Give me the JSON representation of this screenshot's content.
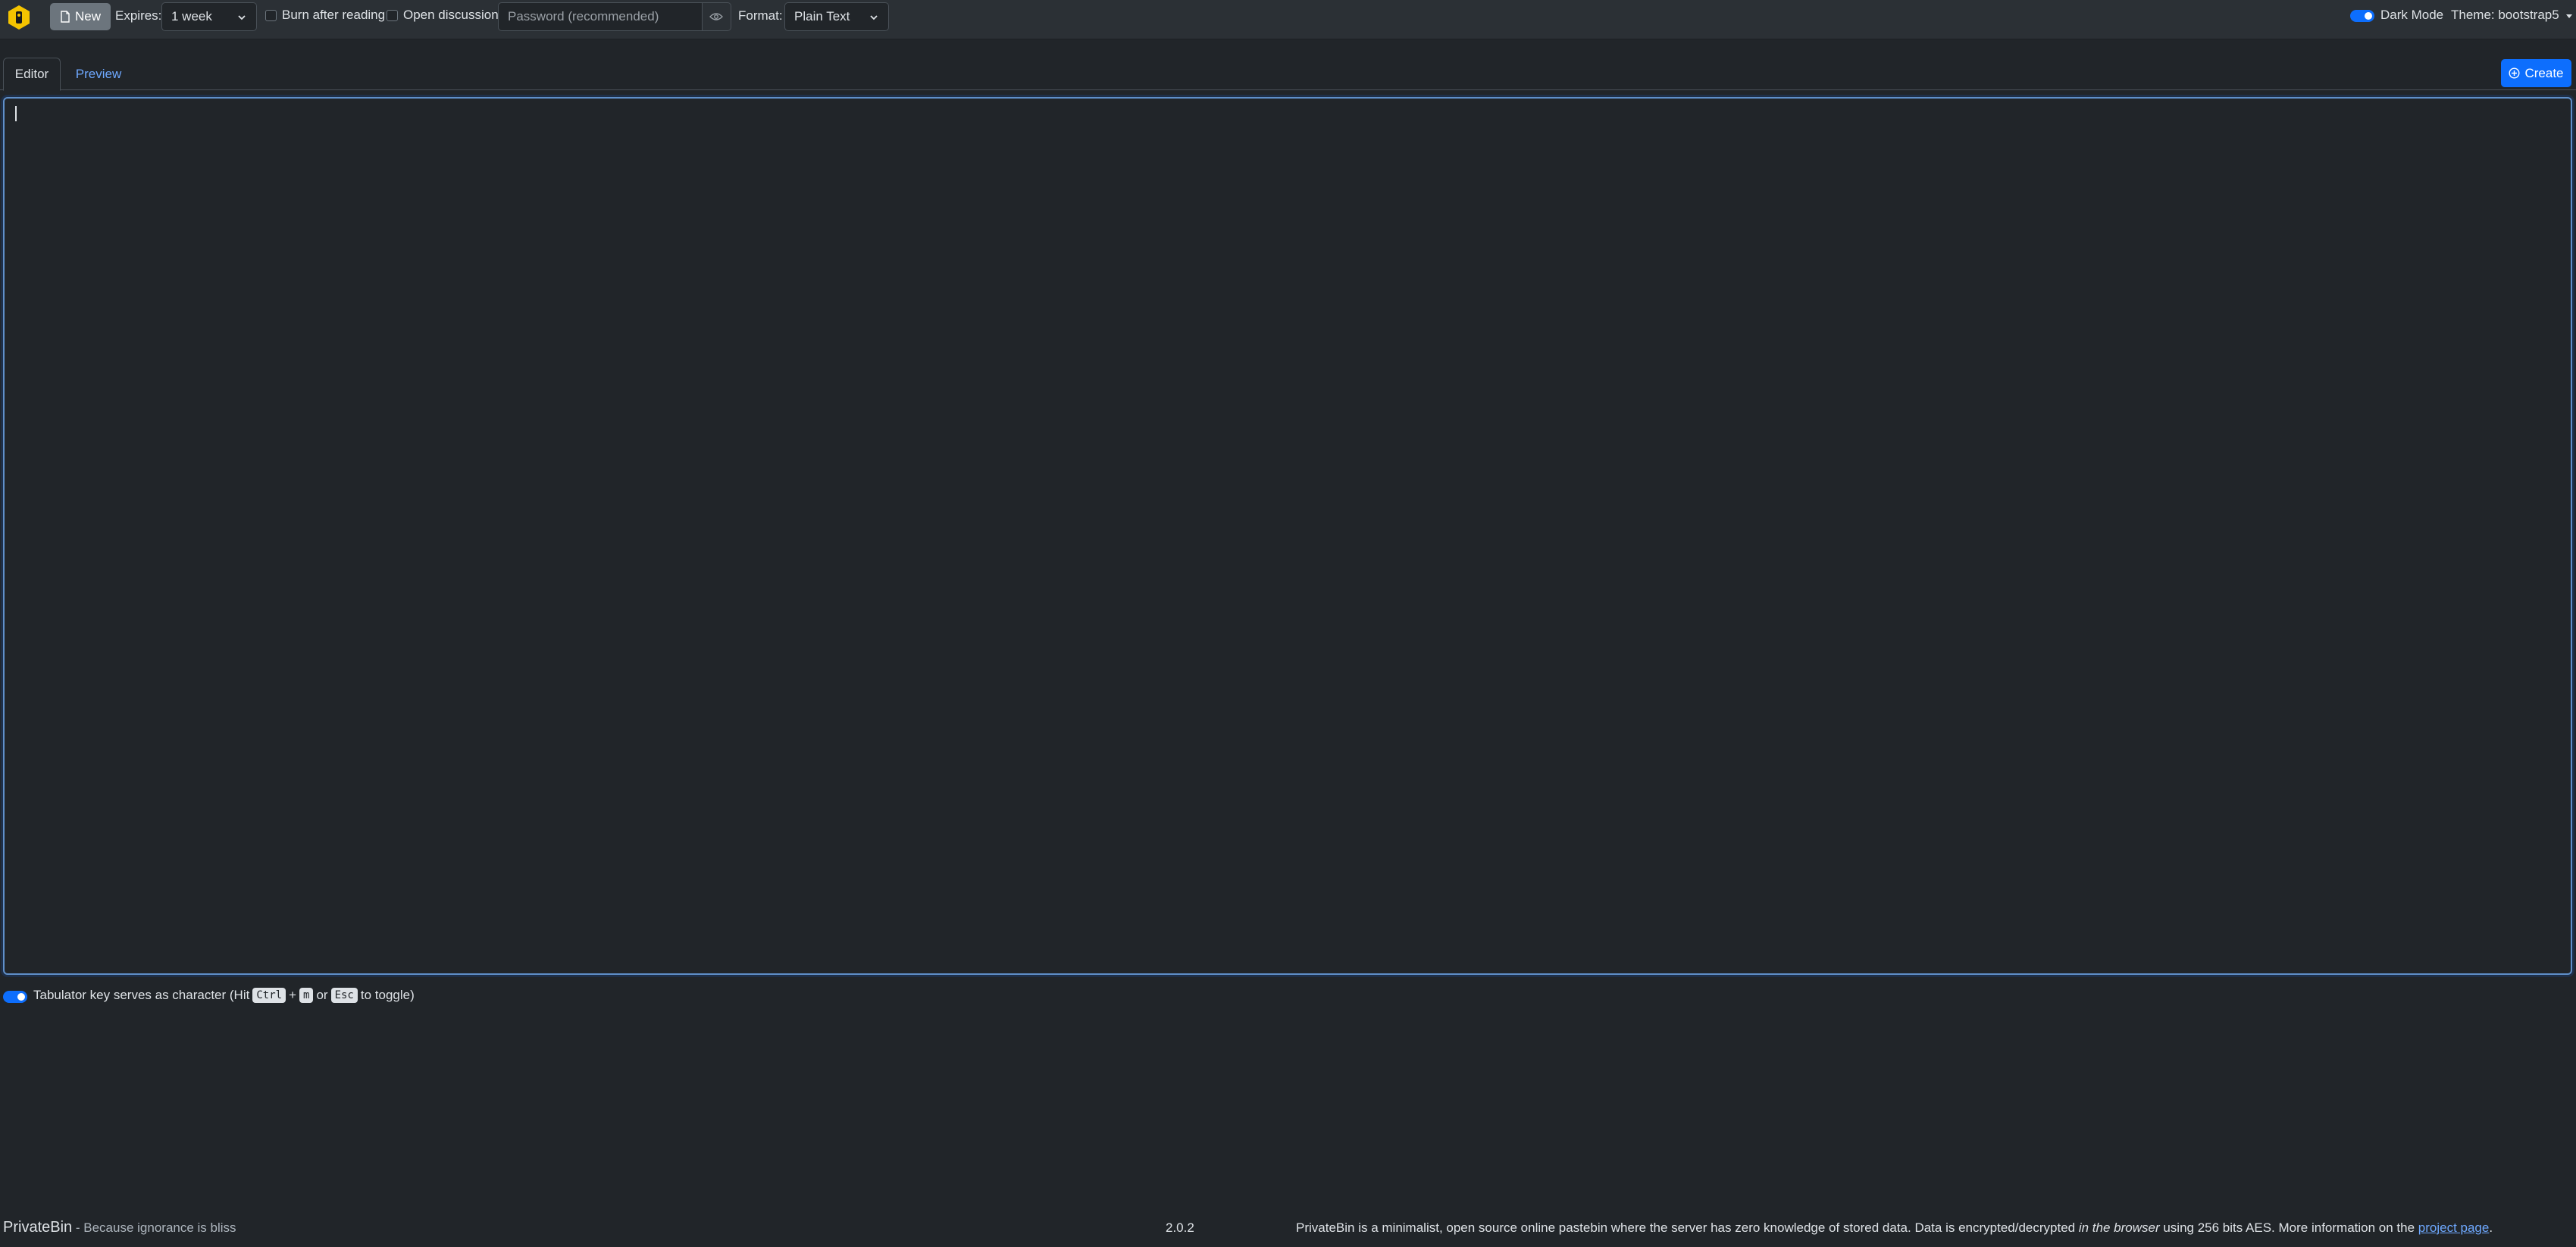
{
  "navbar": {
    "new_label": "New",
    "expires_label": "Expires:",
    "expires_value": "1 week",
    "burn_label": "Burn after reading",
    "discussion_label": "Open discussion",
    "password_placeholder": "Password (recommended)",
    "format_label": "Format:",
    "format_value": "Plain Text",
    "dark_mode_label": "Dark Mode",
    "dark_mode_on": true,
    "theme_label": "Theme: bootstrap5"
  },
  "tabs": {
    "editor_label": "Editor",
    "preview_label": "Preview",
    "create_label": "Create"
  },
  "editor": {
    "content": ""
  },
  "hint": {
    "prefix": "Tabulator key serves as character (Hit",
    "key1": "Ctrl",
    "plus": "+",
    "key2": "m",
    "or": "or",
    "key3": "Esc",
    "suffix": "to toggle)",
    "enabled": true
  },
  "footer": {
    "name": "PrivateBin",
    "slogan": " - Because ignorance is bliss",
    "version": "2.0.2",
    "info_before": "PrivateBin is a minimalist, open source online pastebin where the server has zero knowledge of stored data. Data is encrypted/decrypted ",
    "info_em": "in the browser",
    "info_after": " using 256 bits AES. More information on the ",
    "link_text": "project page",
    "info_end": "."
  },
  "colors": {
    "background": "#212529",
    "navbar": "#2b3035",
    "accent": "#0d6efd",
    "link": "#6ea8fe",
    "logo": "#f5c400"
  },
  "icons": {
    "logo": "privatebin-logo-icon",
    "new": "file-icon",
    "eye": "eye-icon",
    "create": "plus-circle-icon"
  }
}
